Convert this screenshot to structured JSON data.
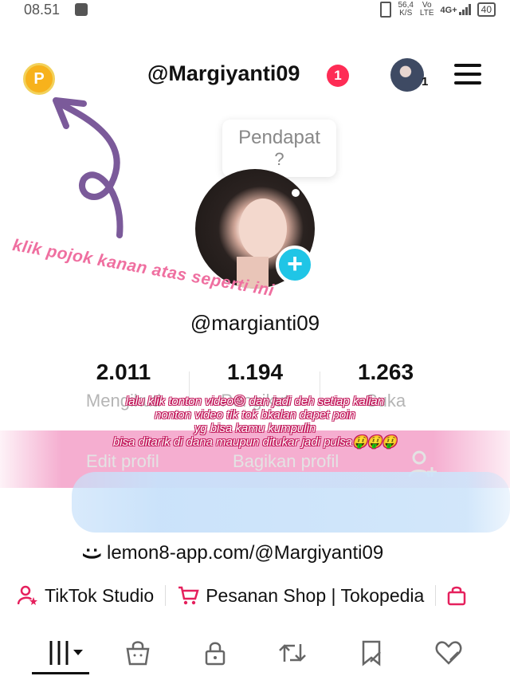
{
  "status_bar": {
    "time": "08.51",
    "speed_value": "56,4",
    "speed_unit": "K/S",
    "volte_top": "Vo",
    "volte_bottom": "LTE",
    "network": "4G+",
    "battery": "40"
  },
  "header": {
    "username": "@Margiyanti09",
    "notification_count": "1",
    "account_count": "1",
    "coin_label": "P"
  },
  "bubble": {
    "line1": "Pendapat",
    "line2": "?"
  },
  "profile": {
    "handle": "@margianti09"
  },
  "stats": [
    {
      "value": "2.011",
      "label": "Mengikuti"
    },
    {
      "value": "1.194",
      "label": "Pengikut"
    },
    {
      "value": "1.263",
      "label": "Suka"
    }
  ],
  "buttons": {
    "edit_profile": "Edit profil",
    "share_profile": "Bagikan profil"
  },
  "annotations": {
    "top_instruction": "klik pojok kanan atas seperti ini",
    "note_line1": "lalu klik tonton video😉 dan jadi deh setiap kalian",
    "note_line2": "nonton video tik tok bkalan dapet poin",
    "note_line3": "yg bisa kamu kumpulin",
    "note_line4": "bisa ditarik di dana maupun ditukar jadi pulsa🤑🤑🤑"
  },
  "bio": {
    "link": "lemon8-app.com/@Margiyanti09"
  },
  "shop_row": {
    "studio": "TikTok Studio",
    "shop": "Pesanan Shop | Tokopedia"
  },
  "colors": {
    "accent_red": "#fe2c55",
    "add_button": "#20c5e6",
    "coin": "#f7b21c",
    "shop_icon": "#e5205d",
    "annotation_pink": "#ef6fa0",
    "arrow_purple": "#7b5a9a"
  },
  "icons": {
    "tabs": [
      "grid-icon",
      "shopping-bag-icon",
      "lock-icon",
      "repost-icon",
      "bookmark-icon",
      "liked-heart-icon"
    ]
  }
}
